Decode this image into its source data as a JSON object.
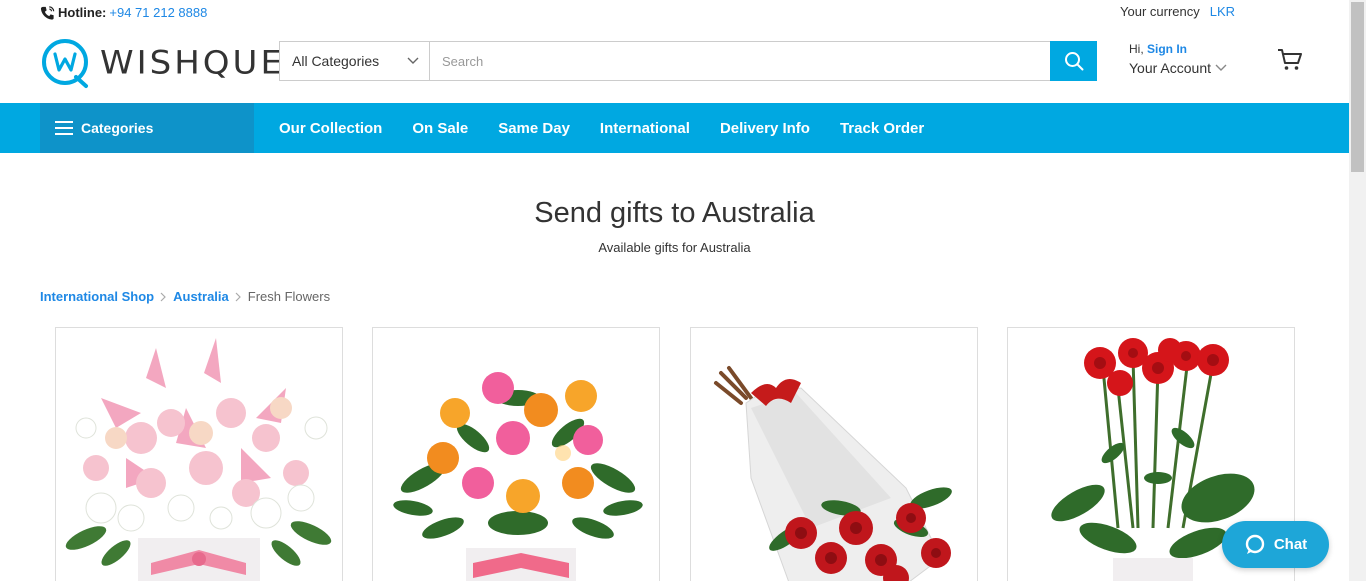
{
  "topbar": {
    "hotline_label": "Hotline:",
    "hotline_number": "+94 71 212 8888",
    "currency_label": "Your currency",
    "currency_code": "LKR"
  },
  "header": {
    "logo_text": "WISHQUE",
    "search": {
      "category_value": "All Categories",
      "placeholder": "Search"
    },
    "account": {
      "hi": "Hi,",
      "sign_in": "Sign In",
      "your_account": "Your Account"
    }
  },
  "nav": {
    "categories_label": "Categories",
    "links": [
      "Our Collection",
      "On Sale",
      "Same Day",
      "International",
      "Delivery Info",
      "Track Order"
    ]
  },
  "page": {
    "title": "Send gifts to Australia",
    "subtitle": "Available gifts for Australia"
  },
  "breadcrumb": [
    "International Shop",
    "Australia",
    "Fresh Flowers"
  ],
  "products": [
    {
      "icon": "pink-lily-rose-box-arrangement"
    },
    {
      "icon": "mixed-rose-box-arrangement"
    },
    {
      "icon": "red-rose-bouquet-wrapped"
    },
    {
      "icon": "red-rose-potted-arrangement"
    }
  ],
  "chat": {
    "label": "Chat"
  },
  "colors": {
    "accent": "#00a8e1",
    "accent_dark": "#0e93c9",
    "link": "#1e88e5",
    "chat": "#1ea6d8"
  }
}
